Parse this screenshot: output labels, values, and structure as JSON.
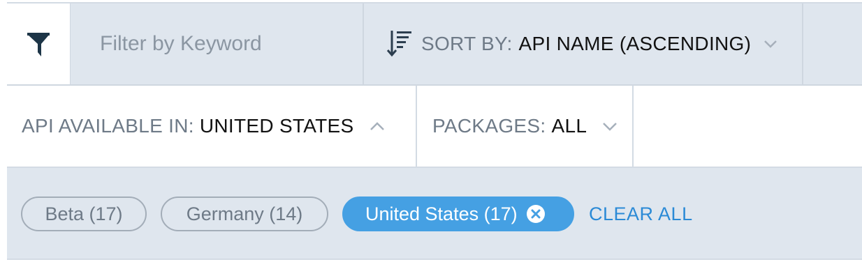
{
  "toolbar": {
    "filter_icon": "filter-funnel-icon",
    "keyword_placeholder": "Filter by Keyword",
    "keyword_value": "",
    "sort_icon": "sort-descending-icon",
    "sort_label": "SORT BY:",
    "sort_value": "API NAME (ASCENDING)"
  },
  "dropdowns": [
    {
      "label": "API AVAILABLE IN:",
      "value": "UNITED STATES",
      "expanded": true
    },
    {
      "label": "PACKAGES:",
      "value": "ALL",
      "expanded": false
    }
  ],
  "chips": [
    {
      "label": "Beta (17)",
      "active": false
    },
    {
      "label": "Germany (14)",
      "active": false
    },
    {
      "label": "United States (17)",
      "active": true
    }
  ],
  "clear_all": "CLEAR ALL",
  "colors": {
    "accent": "#45a0e3",
    "link": "#2b8ad6",
    "toolbar_bg": "#dfe6ee",
    "icon_dark": "#1d3547"
  }
}
